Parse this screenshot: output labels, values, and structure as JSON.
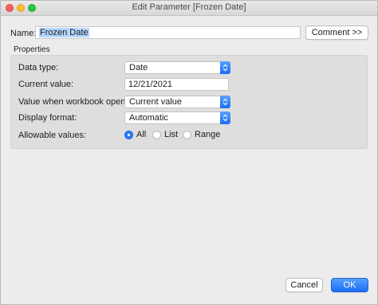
{
  "window": {
    "title": "Edit Parameter [Frozen Date]"
  },
  "name_row": {
    "label": "Name:",
    "value": "Frozen Date",
    "comment_button": "Comment >>"
  },
  "properties": {
    "section_label": "Properties",
    "data_type": {
      "label": "Data type:",
      "value": "Date"
    },
    "current_value": {
      "label": "Current value:",
      "value": "12/21/2021"
    },
    "workbook_opens": {
      "label": "Value when workbook opens:",
      "value": "Current value"
    },
    "display_format": {
      "label": "Display format:",
      "value": "Automatic"
    },
    "allowable_values": {
      "label": "Allowable values:",
      "options": [
        "All",
        "List",
        "Range"
      ],
      "selected": "All"
    }
  },
  "footer": {
    "cancel": "Cancel",
    "ok": "OK"
  },
  "colors": {
    "accent": "#2a7cf6",
    "window_bg": "#ececec",
    "group_bg": "#dedede"
  }
}
